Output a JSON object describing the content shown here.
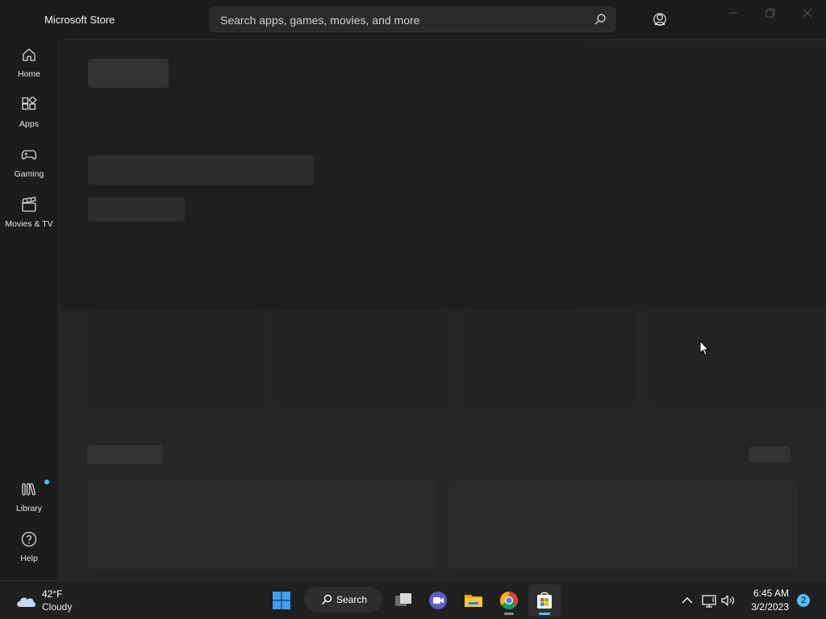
{
  "app": {
    "title": "Microsoft Store"
  },
  "search": {
    "placeholder": "Search apps, games, movies, and more"
  },
  "sidebar": {
    "items": [
      {
        "label": "Home",
        "icon": "home-icon"
      },
      {
        "label": "Apps",
        "icon": "apps-icon"
      },
      {
        "label": "Gaming",
        "icon": "gamepad-icon"
      },
      {
        "label": "Movies & TV",
        "icon": "clapperboard-icon"
      }
    ],
    "bottom_items": [
      {
        "label": "Library",
        "icon": "library-icon",
        "has_update_dot": true
      },
      {
        "label": "Help",
        "icon": "help-icon"
      }
    ]
  },
  "taskbar": {
    "weather": {
      "temp": "42°F",
      "condition": "Cloudy",
      "icon": "cloud-icon"
    },
    "search_label": "Search",
    "clock": {
      "time": "6:45 AM",
      "date": "3/2/2023"
    },
    "notifications": "2",
    "apps": [
      "windows-start-icon",
      "search-icon",
      "task-view-icon",
      "teams-chat-icon",
      "file-explorer-icon",
      "chrome-icon",
      "microsoft-store-icon"
    ]
  },
  "colors": {
    "background": "#1c1c1c",
    "content": "#262626",
    "accent": "#4cc2ff"
  }
}
